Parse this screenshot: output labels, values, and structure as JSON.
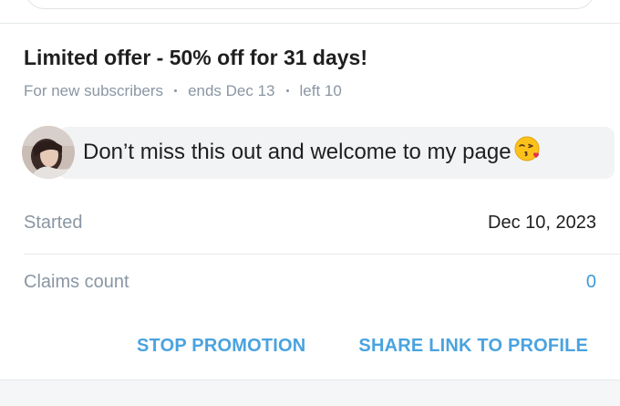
{
  "offer": {
    "title": "Limited offer - 50% off for 31 days!",
    "audience": "For new subscribers",
    "ends": "ends Dec 13",
    "left": "left 10"
  },
  "message": {
    "text": "Don’t miss this out and welcome to my page",
    "emoji_icon": "face-blowing-kiss-icon"
  },
  "details": {
    "started_label": "Started",
    "started_value": "Dec 10, 2023",
    "claims_label": "Claims count",
    "claims_value": "0"
  },
  "actions": {
    "stop_label": "STOP PROMOTION",
    "share_label": "SHARE LINK TO PROFILE"
  },
  "colors": {
    "accent": "#4aa3df",
    "muted": "#8a96a3",
    "bubble": "#f2f3f5"
  }
}
